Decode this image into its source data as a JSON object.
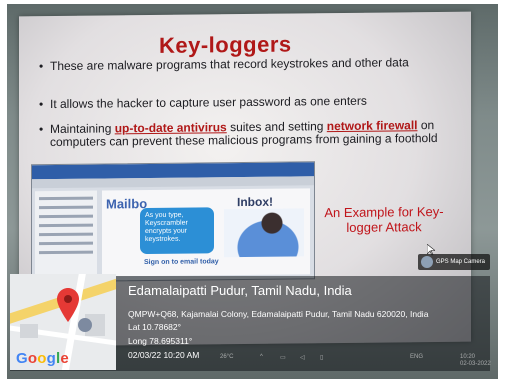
{
  "slide": {
    "title": "Key-loggers",
    "bullets": {
      "b1": "These are malware programs that record keystrokes and other data",
      "b2": "It allows the hacker to capture user password as one enters",
      "b3_pre": "Maintaining ",
      "b3_red1": "up-to-date antivirus",
      "b3_mid": " suites and setting ",
      "b3_red2": "network firewall",
      "b3_post": " on computers can prevent these malicious programs from gaining a foothold"
    },
    "caption": "An Example for Key-logger Attack",
    "screenshot": {
      "logo": "Mailbo",
      "inbox": "Inbox!",
      "bubble": "As you type, Keyscrambler encrypts your keystrokes.",
      "signin": "Sign on to email today"
    }
  },
  "overlay": {
    "camera_badge": "GPS Map Camera",
    "place": "Edamalaipatti Pudur, Tamil Nadu, India",
    "address": "QMPW+Q68, Kajamalai Colony, Edamalaipatti Pudur, Tamil Nadu 620020, India",
    "lat": "Lat 10.78682°",
    "long": "Long 78.695311°",
    "datetime": "02/03/22 10:20 AM",
    "google": "Google",
    "temp": "26°C",
    "lang": "ENG",
    "clock_time": "10:20",
    "clock_date": "02-03-2022"
  },
  "colors": {
    "slide_red": "#b01818",
    "overlay_bg": "#14181c"
  }
}
